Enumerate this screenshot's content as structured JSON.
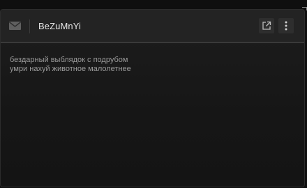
{
  "header": {
    "username": "BeZuMnYi",
    "icons": {
      "mail": "mail-icon",
      "popout": "external-link-icon",
      "menu": "more-vertical-icon"
    }
  },
  "message": {
    "lines": [
      "бездарный выблядок с подрубом",
      "умри нахуй животное малолетнее"
    ]
  },
  "colors": {
    "background": "#0f0f0f",
    "panel": "#1a1a1a",
    "header": "#232323",
    "text_primary": "#e6e6e6",
    "text_secondary": "#9a9a9a"
  }
}
